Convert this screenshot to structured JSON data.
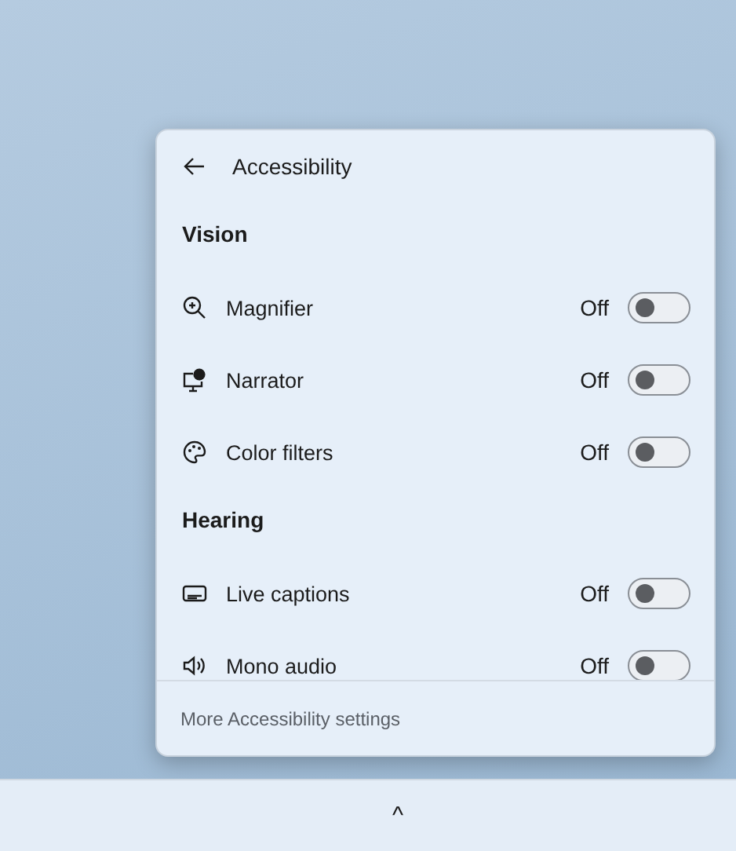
{
  "panel": {
    "title": "Accessibility",
    "sections": [
      {
        "heading": "Vision",
        "items": [
          {
            "kind": "magnifier",
            "label": "Magnifier",
            "status": "Off",
            "on": false
          },
          {
            "kind": "narrator",
            "label": "Narrator",
            "status": "Off",
            "on": false
          },
          {
            "kind": "palette",
            "label": "Color filters",
            "status": "Off",
            "on": false
          }
        ]
      },
      {
        "heading": "Hearing",
        "items": [
          {
            "kind": "captions",
            "label": "Live captions",
            "status": "Off",
            "on": false
          },
          {
            "kind": "speaker",
            "label": "Mono audio",
            "status": "Off",
            "on": false
          }
        ]
      }
    ],
    "footer_link": "More Accessibility settings"
  },
  "taskbar": {
    "tray_caret": "^"
  }
}
